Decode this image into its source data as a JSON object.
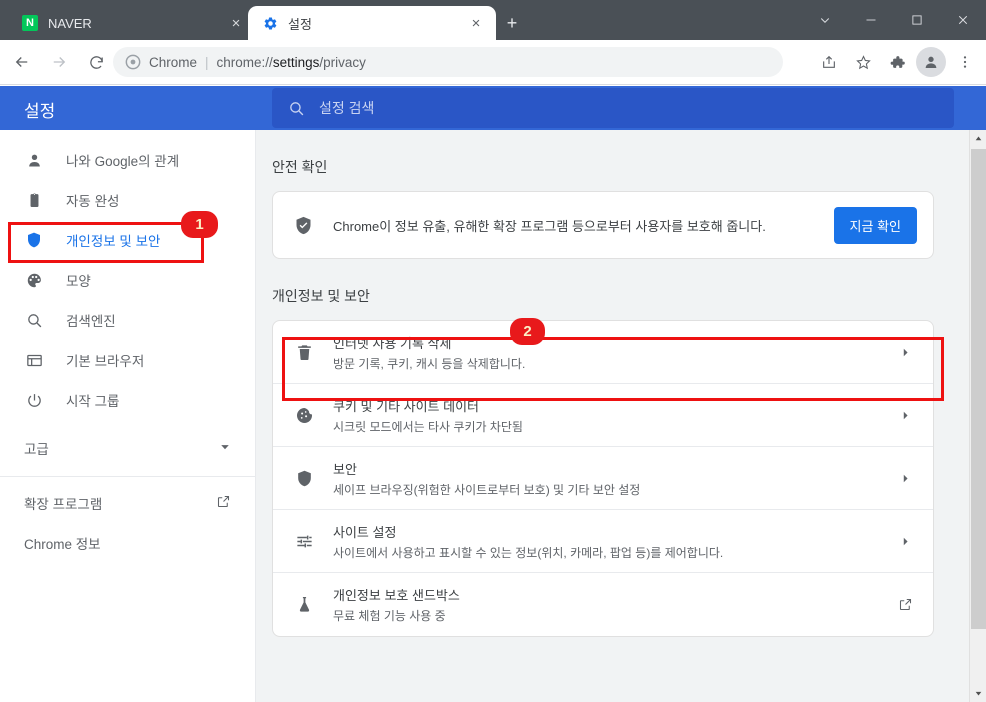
{
  "window": {
    "controls": [
      {
        "name": "tab-search-chevron",
        "glyph": "chevron-down"
      },
      {
        "name": "minimize",
        "glyph": "minimize"
      },
      {
        "name": "maximize",
        "glyph": "maximize"
      },
      {
        "name": "close",
        "glyph": "close"
      }
    ]
  },
  "tabs": [
    {
      "title": "NAVER",
      "favicon": "naver-icon",
      "active": false,
      "close_label": "×"
    },
    {
      "title": "설정",
      "favicon": "gear-icon",
      "active": true,
      "close_label": "×"
    }
  ],
  "newtab_label": "+",
  "toolbar": {
    "back_label": "←",
    "forward_label": "→",
    "reload_label": "⟳",
    "omnibox": {
      "chip": "Chrome",
      "separator": "|",
      "url_prefix": "chrome://",
      "url_bold": "settings",
      "url_suffix": "/privacy"
    },
    "actions": [
      "share-icon",
      "bookmark-star-icon",
      "extensions-puzzle-icon",
      "profile-avatar-icon",
      "more-vertical-icon"
    ]
  },
  "settings": {
    "title": "설정",
    "search_placeholder": "설정 검색",
    "header_color": "#3367d6",
    "search_bg": "#2a56c6"
  },
  "sidebar": {
    "items": [
      {
        "label": "나와 Google의 관계",
        "icon": "person-icon",
        "selected": false
      },
      {
        "label": "자동 완성",
        "icon": "clipboard-icon",
        "selected": false
      },
      {
        "label": "개인정보 및 보안",
        "icon": "shield-icon",
        "selected": true
      },
      {
        "label": "모양",
        "icon": "palette-icon",
        "selected": false
      },
      {
        "label": "검색엔진",
        "icon": "search-icon",
        "selected": false
      },
      {
        "label": "기본 브라우저",
        "icon": "browser-window-icon",
        "selected": false
      },
      {
        "label": "시작 그룹",
        "icon": "power-icon",
        "selected": false
      }
    ],
    "advanced": {
      "label": "고급",
      "icon": "chevron-down-icon"
    },
    "footer": [
      {
        "label": "확장 프로그램",
        "icon": "external-link-icon"
      },
      {
        "label": "Chrome 정보",
        "icon": null
      }
    ]
  },
  "main": {
    "safety_check": {
      "section_title": "안전 확인",
      "icon": "shield-check-icon",
      "text": "Chrome이 정보 유출, 유해한 확장 프로그램 등으로부터 사용자를 보호해 줍니다.",
      "button_label": "지금 확인"
    },
    "privacy": {
      "section_title": "개인정보 및 보안",
      "rows": [
        {
          "title": "인터넷 사용 기록 삭제",
          "subtitle": "방문 기록, 쿠키, 캐시 등을 삭제합니다.",
          "icon": "trash-icon",
          "action": "chevron-right-icon"
        },
        {
          "title": "쿠키 및 기타 사이트 데이터",
          "subtitle": "시크릿 모드에서는 타사 쿠키가 차단됨",
          "icon": "cookie-icon",
          "action": "chevron-right-icon"
        },
        {
          "title": "보안",
          "subtitle": "세이프 브라우징(위험한 사이트로부터 보호) 및 기타 보안 설정",
          "icon": "shield-icon",
          "action": "chevron-right-icon"
        },
        {
          "title": "사이트 설정",
          "subtitle": "사이트에서 사용하고 표시할 수 있는 정보(위치, 카메라, 팝업 등)를 제어합니다.",
          "icon": "sliders-icon",
          "action": "chevron-right-icon"
        },
        {
          "title": "개인정보 보호 샌드박스",
          "subtitle": "무료 체험 기능 사용 중",
          "icon": "flask-icon",
          "action": "external-link-icon"
        }
      ]
    }
  },
  "annotations": [
    {
      "badge": "1",
      "target": "sidebar-item-privacy"
    },
    {
      "badge": "2",
      "target": "clear-browsing-data-row"
    }
  ],
  "colors": {
    "accent_blue": "#1a73e8",
    "header_blue": "#3367d6",
    "annotation_red": "#ee1111",
    "badge_red": "#e8191b",
    "naver_green": "#03c75a"
  }
}
